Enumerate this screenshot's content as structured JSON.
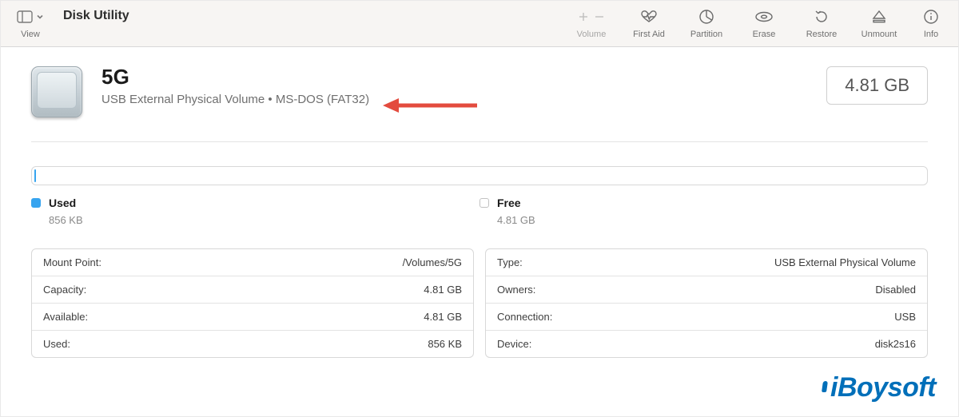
{
  "app_title": "Disk Utility",
  "toolbar": {
    "view_label": "View",
    "items": [
      {
        "id": "volume",
        "label": "Volume",
        "disabled": true
      },
      {
        "id": "firstaid",
        "label": "First Aid"
      },
      {
        "id": "partition",
        "label": "Partition"
      },
      {
        "id": "erase",
        "label": "Erase"
      },
      {
        "id": "restore",
        "label": "Restore"
      },
      {
        "id": "unmount",
        "label": "Unmount"
      },
      {
        "id": "info",
        "label": "Info"
      }
    ]
  },
  "volume": {
    "name": "5G",
    "subtitle": "USB External Physical Volume • MS-DOS (FAT32)",
    "size_display": "4.81 GB"
  },
  "usage": {
    "used_label": "Used",
    "used_value": "856 KB",
    "free_label": "Free",
    "free_value": "4.81 GB",
    "used_fraction": 0.0002
  },
  "details": {
    "left": [
      {
        "label": "Mount Point:",
        "value": "/Volumes/5G"
      },
      {
        "label": "Capacity:",
        "value": "4.81 GB"
      },
      {
        "label": "Available:",
        "value": "4.81 GB"
      },
      {
        "label": "Used:",
        "value": "856 KB"
      }
    ],
    "right": [
      {
        "label": "Type:",
        "value": "USB External Physical Volume"
      },
      {
        "label": "Owners:",
        "value": "Disabled"
      },
      {
        "label": "Connection:",
        "value": "USB"
      },
      {
        "label": "Device:",
        "value": "disk2s16"
      }
    ]
  },
  "brand": "iBoysoft",
  "colors": {
    "accent_blue": "#1a7ff1",
    "used_swatch": "#37a4ef",
    "brand": "#006fb9",
    "annotation_arrow": "#e34b3e"
  }
}
